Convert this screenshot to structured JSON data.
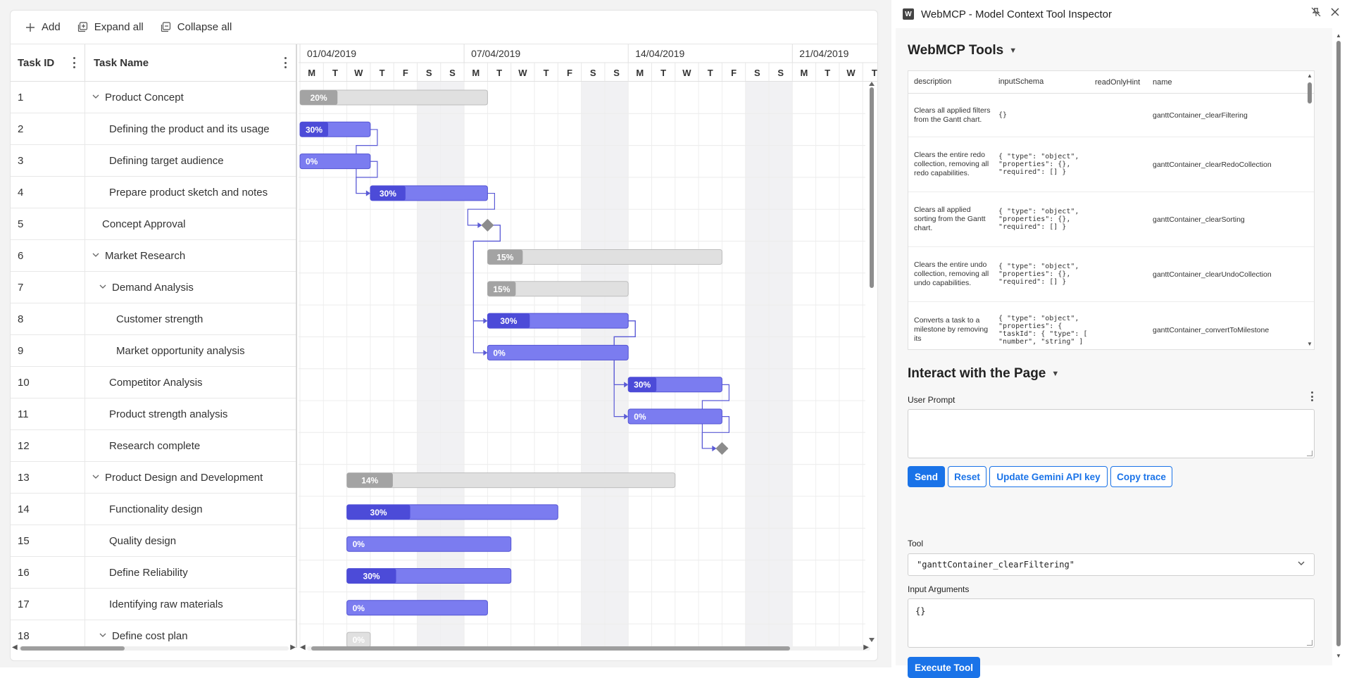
{
  "toolbar": {
    "add_label": "Add",
    "expand_label": "Expand all",
    "collapse_label": "Collapse all"
  },
  "grid": {
    "col_id": "Task ID",
    "col_name": "Task Name"
  },
  "timeline": {
    "weeks": [
      "01/04/2019",
      "07/04/2019",
      "14/04/2019",
      "21/04/2019"
    ],
    "days": [
      "M",
      "T",
      "W",
      "T",
      "F",
      "S",
      "S",
      "M",
      "T",
      "W",
      "T",
      "F",
      "S",
      "S",
      "M",
      "T",
      "W",
      "T",
      "F",
      "S",
      "S",
      "M",
      "T",
      "W",
      "T"
    ]
  },
  "tasks": [
    {
      "id": "1",
      "name": "Product Concept",
      "level": 0,
      "expandable": true,
      "start": 1,
      "dur": 8,
      "progress": 20,
      "kind": "parent"
    },
    {
      "id": "2",
      "name": "Defining the product and its usage",
      "level": 1,
      "expandable": false,
      "start": 1,
      "dur": 3,
      "progress": 30,
      "kind": "task"
    },
    {
      "id": "3",
      "name": "Defining target audience",
      "level": 1,
      "expandable": false,
      "start": 1,
      "dur": 3,
      "progress": 0,
      "kind": "task"
    },
    {
      "id": "4",
      "name": "Prepare product sketch and notes",
      "level": 1,
      "expandable": false,
      "start": 4,
      "dur": 5,
      "progress": 30,
      "kind": "task"
    },
    {
      "id": "5",
      "name": "Concept Approval",
      "level": 0,
      "expandable": false,
      "start": 9,
      "dur": 0,
      "progress": 0,
      "kind": "milestone"
    },
    {
      "id": "6",
      "name": "Market Research",
      "level": 0,
      "expandable": true,
      "start": 9,
      "dur": 10,
      "progress": 15,
      "kind": "parent"
    },
    {
      "id": "7",
      "name": "Demand Analysis",
      "level": 1,
      "expandable": true,
      "start": 9,
      "dur": 6,
      "progress": 15,
      "kind": "parent"
    },
    {
      "id": "8",
      "name": "Customer strength",
      "level": 2,
      "expandable": false,
      "start": 9,
      "dur": 6,
      "progress": 30,
      "kind": "task"
    },
    {
      "id": "9",
      "name": "Market opportunity analysis",
      "level": 2,
      "expandable": false,
      "start": 9,
      "dur": 6,
      "progress": 0,
      "kind": "task"
    },
    {
      "id": "10",
      "name": "Competitor Analysis",
      "level": 1,
      "expandable": false,
      "start": 15,
      "dur": 4,
      "progress": 30,
      "kind": "task"
    },
    {
      "id": "11",
      "name": "Product strength analysis",
      "level": 1,
      "expandable": false,
      "start": 15,
      "dur": 4,
      "progress": 0,
      "kind": "task"
    },
    {
      "id": "12",
      "name": "Research complete",
      "level": 1,
      "expandable": false,
      "start": 19,
      "dur": 0,
      "progress": 0,
      "kind": "milestone"
    },
    {
      "id": "13",
      "name": "Product Design and Development",
      "level": 0,
      "expandable": true,
      "start": 3,
      "dur": 14,
      "progress": 14,
      "kind": "parent"
    },
    {
      "id": "14",
      "name": "Functionality design",
      "level": 1,
      "expandable": false,
      "start": 3,
      "dur": 9,
      "progress": 30,
      "kind": "task"
    },
    {
      "id": "15",
      "name": "Quality design",
      "level": 1,
      "expandable": false,
      "start": 3,
      "dur": 7,
      "progress": 0,
      "kind": "task"
    },
    {
      "id": "16",
      "name": "Define Reliability",
      "level": 1,
      "expandable": false,
      "start": 3,
      "dur": 7,
      "progress": 30,
      "kind": "task"
    },
    {
      "id": "17",
      "name": "Identifying raw materials",
      "level": 1,
      "expandable": false,
      "start": 3,
      "dur": 6,
      "progress": 0,
      "kind": "task"
    },
    {
      "id": "18",
      "name": "Define cost plan",
      "level": 1,
      "expandable": true,
      "start": 3,
      "dur": 1,
      "progress": 0,
      "kind": "parent"
    }
  ],
  "colors": {
    "task_bar": "#7b7cf0",
    "task_progress": "#4c4bd8",
    "parent_bar": "#e0e0e0",
    "parent_progress": "#a3a3a3",
    "weekend": "#f1f1f3",
    "connector": "#5b5bd6",
    "accent": "#1a73e8"
  },
  "inspector": {
    "title": "WebMCP - Model Context Tool Inspector",
    "app_icon": "W",
    "tools_heading": "WebMCP Tools",
    "table_headers": [
      "description",
      "inputSchema",
      "readOnlyHint",
      "name"
    ],
    "tools": [
      {
        "description": "Clears all applied filters from the Gantt chart.",
        "schema": "{}",
        "readOnly": "",
        "name": "ganttContainer_clearFiltering"
      },
      {
        "description": "Clears the entire redo collection, removing all redo capabilities.",
        "schema": "{ \"type\": \"object\",\n\"properties\": {},\n\"required\": [] }",
        "readOnly": "",
        "name": "ganttContainer_clearRedoCollection"
      },
      {
        "description": "Clears all applied sorting from the Gantt chart.",
        "schema": "{ \"type\": \"object\",\n\"properties\": {},\n\"required\": [] }",
        "readOnly": "",
        "name": "ganttContainer_clearSorting"
      },
      {
        "description": "Clears the entire undo collection, removing all undo capabilities.",
        "schema": "{ \"type\": \"object\",\n\"properties\": {},\n\"required\": [] }",
        "readOnly": "",
        "name": "ganttContainer_clearUndoCollection"
      },
      {
        "description": "Converts a task to a milestone by removing its",
        "schema": "{ \"type\": \"object\",\n\"properties\": {\n\"taskId\": { \"type\": [\n\"number\", \"string\" ]",
        "readOnly": "",
        "name": "ganttContainer_convertToMilestone"
      }
    ],
    "interact_heading": "Interact with the Page",
    "user_prompt_label": "User Prompt",
    "user_prompt_value": "",
    "send_label": "Send",
    "reset_label": "Reset",
    "update_key_label": "Update Gemini API key",
    "copy_trace_label": "Copy trace",
    "tool_label": "Tool",
    "tool_selected": "\"ganttContainer_clearFiltering\"",
    "input_args_label": "Input Arguments",
    "input_args_value": "{}",
    "execute_label": "Execute Tool"
  }
}
